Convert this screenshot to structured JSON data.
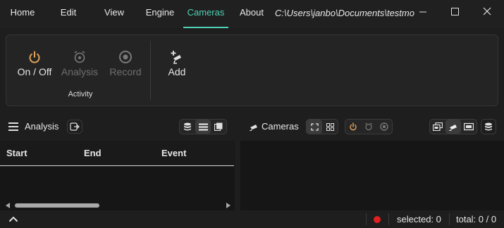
{
  "menu": {
    "home": "Home",
    "edit": "Edit",
    "view": "View",
    "engine": "Engine",
    "cameras": "Cameras",
    "about": "About"
  },
  "path": "C:\\Users\\janbo\\Documents\\testmo",
  "ribbon": {
    "on_off": "On / Off",
    "analysis": "Analysis",
    "record": "Record",
    "group_activity": "Activity",
    "add": "Add"
  },
  "analysis_panel": {
    "title": "Analysis",
    "columns": [
      "Start",
      "End",
      "Event"
    ]
  },
  "cameras_panel": {
    "title": "Cameras"
  },
  "status": {
    "selected": "selected: 0",
    "total": "total: 0 / 0"
  },
  "colors": {
    "accent": "#4fd1b5",
    "power": "#e0a35a",
    "record_dot": "#e02020"
  },
  "icons": [
    "power-icon",
    "analysis-icon",
    "record-icon",
    "add-camera-icon",
    "hamburger-icon",
    "export-icon",
    "database-icon",
    "list-icon",
    "book-icon",
    "camera-icon",
    "fullscreen-icon",
    "grid-icon",
    "stack-icon",
    "display-icon",
    "chevron-up-icon"
  ]
}
